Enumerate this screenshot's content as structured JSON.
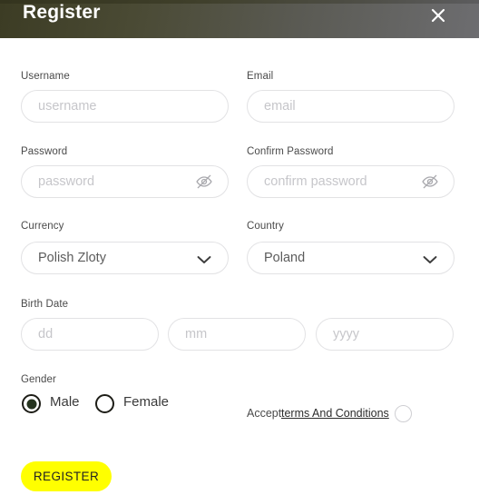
{
  "header": {
    "title": "Register",
    "close_label": "Close",
    "gradient_from": "#3c3c24",
    "gradient_to": "#6d6d70"
  },
  "form": {
    "fields": [
      {
        "label": "Username",
        "placeholder": "username",
        "value": "",
        "type": "text"
      },
      {
        "label": "Email",
        "placeholder": "email",
        "value": "",
        "type": "text"
      },
      {
        "label": "Password",
        "placeholder": "password",
        "value": "",
        "type": "password"
      },
      {
        "label": "Confirm Password",
        "placeholder": "confirm password",
        "value": "",
        "type": "password"
      },
      {
        "label": "Currency",
        "placeholder": "",
        "value": "Polish Zloty",
        "type": "select"
      },
      {
        "label": "Country",
        "placeholder": "",
        "value": "Poland",
        "type": "select"
      }
    ],
    "birth_date": {
      "label": "Birth Date",
      "day_placeholder": "dd",
      "month_placeholder": "mm",
      "year_placeholder": "yyyy",
      "day_value": "",
      "month_value": "",
      "year_value": ""
    },
    "gender": {
      "label": "Gender",
      "options": [
        {
          "label": "Male",
          "selected": true
        },
        {
          "label": "Female",
          "selected": false
        }
      ]
    },
    "terms": {
      "accept_text": "Accept",
      "link_text": "terms And Conditions",
      "checked": false
    },
    "submit": {
      "label": "REGISTER",
      "color": "#ffff00",
      "text_color": "#222222"
    }
  },
  "icons": {
    "close": "close-icon",
    "eye_off": "eye-off-icon",
    "chevron_down": "chevron-down-icon"
  }
}
